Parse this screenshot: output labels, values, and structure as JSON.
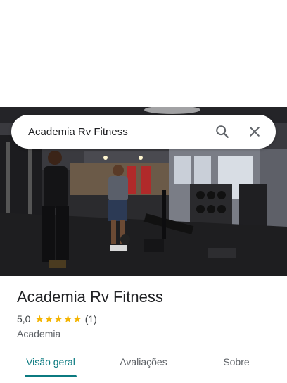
{
  "search": {
    "query": "Academia Rv Fitness"
  },
  "icons": {
    "search": "search-icon",
    "close": "close-icon",
    "star": "star-icon"
  },
  "place": {
    "name": "Academia Rv Fitness",
    "rating": "5,0",
    "review_count": "(1)",
    "stars": 5,
    "category": "Academia"
  },
  "tabs": [
    {
      "label": "Visão geral",
      "active": true
    },
    {
      "label": "Avaliações",
      "active": false
    },
    {
      "label": "Sobre",
      "active": false
    }
  ],
  "colors": {
    "accent": "#0b7a80",
    "star": "#f4b400"
  }
}
